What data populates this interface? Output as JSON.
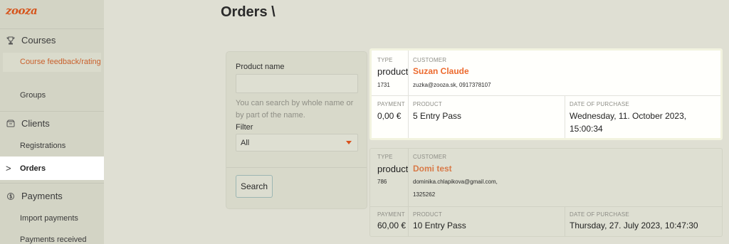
{
  "app": {
    "logo_text": "zooza"
  },
  "sidebar": {
    "courses": {
      "label": "Courses",
      "icon": "trophy-icon"
    },
    "course_feedback": "Course feedback/rating",
    "groups": "Groups",
    "clients": {
      "label": "Clients",
      "icon": "box-icon"
    },
    "registrations": "Registrations",
    "orders": "Orders",
    "payments": {
      "label": "Payments",
      "icon": "dollar-icon"
    },
    "import_payments": "Import payments",
    "payments_received": "Payments received"
  },
  "page": {
    "title": "Orders \\"
  },
  "filter": {
    "product_label": "Product name",
    "product_value": "",
    "hint": "You can search by whole name or by part of the name.",
    "filter_label": "Filter",
    "filter_value": "All",
    "search_button": "Search"
  },
  "labels": {
    "type": "TYPE",
    "customer": "CUSTOMER",
    "payment": "PAYMENT",
    "product": "PRODUCT",
    "date": "DATE OF PURCHASE"
  },
  "orders": [
    {
      "type": "product",
      "id": "1731",
      "customer_name": "Suzan Claude",
      "customer_contact": "zuzka@zooza.sk, 0917378107",
      "payment": "0,00 €",
      "product": "5 Entry Pass",
      "date_line1": "Wednesday, 11. October 2023,",
      "date_line2": "15:00:34"
    },
    {
      "type": "product",
      "id": "786",
      "customer_name": "Domi test",
      "customer_contact_line1": "dominika.chlapikova@gmail.com,",
      "customer_contact_line2": "1325262",
      "payment": "60,00 €",
      "product": "10 Entry Pass",
      "date_line1": "Thursday, 27. July 2023, 10:47:30"
    }
  ],
  "colors": {
    "accent": "#ec6a2e",
    "background": "#dfdfd3",
    "sidebar": "#d3d4c5"
  }
}
